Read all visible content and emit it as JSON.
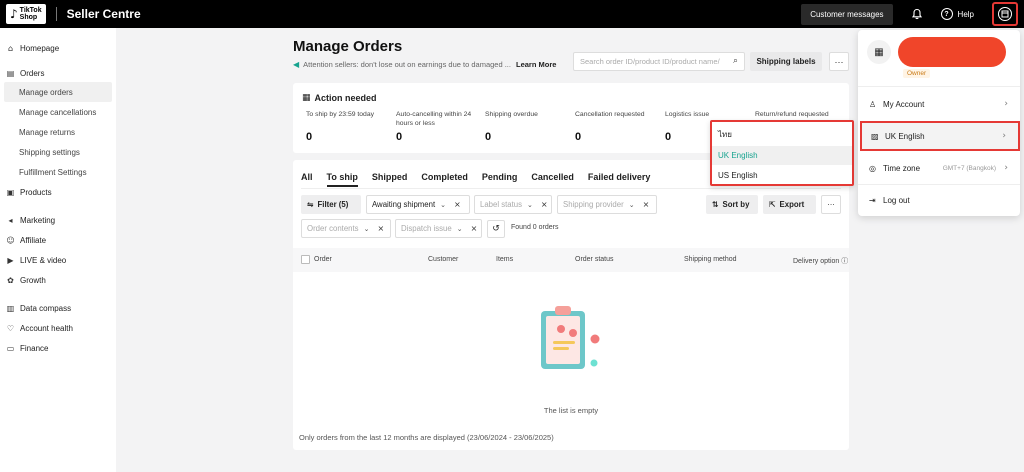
{
  "topbar": {
    "logo_line1": "TikTok",
    "logo_line2": "Shop",
    "app_title": "Seller Centre",
    "customer_messages": "Customer messages",
    "help_label": "Help"
  },
  "sidebar": {
    "homepage": "Homepage",
    "orders": "Orders",
    "orders_sub": [
      "Manage orders",
      "Manage cancellations",
      "Manage returns",
      "Shipping settings",
      "Fulfillment Settings"
    ],
    "products": "Products",
    "marketing": "Marketing",
    "affiliate": "Affiliate",
    "live_video": "LIVE & video",
    "growth": "Growth",
    "data_compass": "Data compass",
    "account_health": "Account health",
    "finance": "Finance"
  },
  "main": {
    "title": "Manage Orders",
    "notice": "Attention sellers: don't lose out on earnings due to damaged ...",
    "learn_more": "Learn More",
    "search_placeholder": "Search order ID/product ID/product name/",
    "shipping_labels": "Shipping labels",
    "more": "···"
  },
  "action_needed": {
    "title": "Action needed",
    "metrics": [
      {
        "label": "To ship by 23:59 today",
        "value": "0"
      },
      {
        "label": "Auto-cancelling within 24 hours or less",
        "value": "0"
      },
      {
        "label": "Shipping overdue",
        "value": "0"
      },
      {
        "label": "Cancellation requested",
        "value": "0"
      },
      {
        "label": "Logistics issue",
        "value": "0"
      },
      {
        "label": "Return/refund requested",
        "value": ""
      }
    ]
  },
  "orders": {
    "tabs": [
      "All",
      "To ship",
      "Shipped",
      "Completed",
      "Pending",
      "Cancelled",
      "Failed delivery"
    ],
    "active_tab": "To ship",
    "filter_label": "Filter",
    "filter_count": "(5)",
    "awaiting_shipment": "Awaiting shipment",
    "label_status": "Label status",
    "shipping_provider": "Shipping provider",
    "order_contents": "Order contents",
    "dispatch_issue": "Dispatch issue",
    "found": "Found 0 orders",
    "sort_by": "Sort by",
    "export": "Export",
    "columns": [
      "Order",
      "Customer",
      "Items",
      "Order status",
      "Shipping method",
      "Delivery option"
    ],
    "empty": "The list is empty",
    "footnote": "Only orders from the last 12 months are displayed (23/06/2024 - 23/06/2025)"
  },
  "language_menu": {
    "options": [
      "ไทย",
      "UK English",
      "US English"
    ],
    "selected": "UK English"
  },
  "account_menu": {
    "owner_badge": "Owner",
    "my_account": "My Account",
    "language": "UK English",
    "time_zone": "Time zone",
    "time_zone_value": "GMT+7 (Bangkok)",
    "log_out": "Log out"
  },
  "colors": {
    "accent_teal": "#17a38f",
    "highlight_red": "#e53935",
    "redaction": "#f0452a"
  }
}
